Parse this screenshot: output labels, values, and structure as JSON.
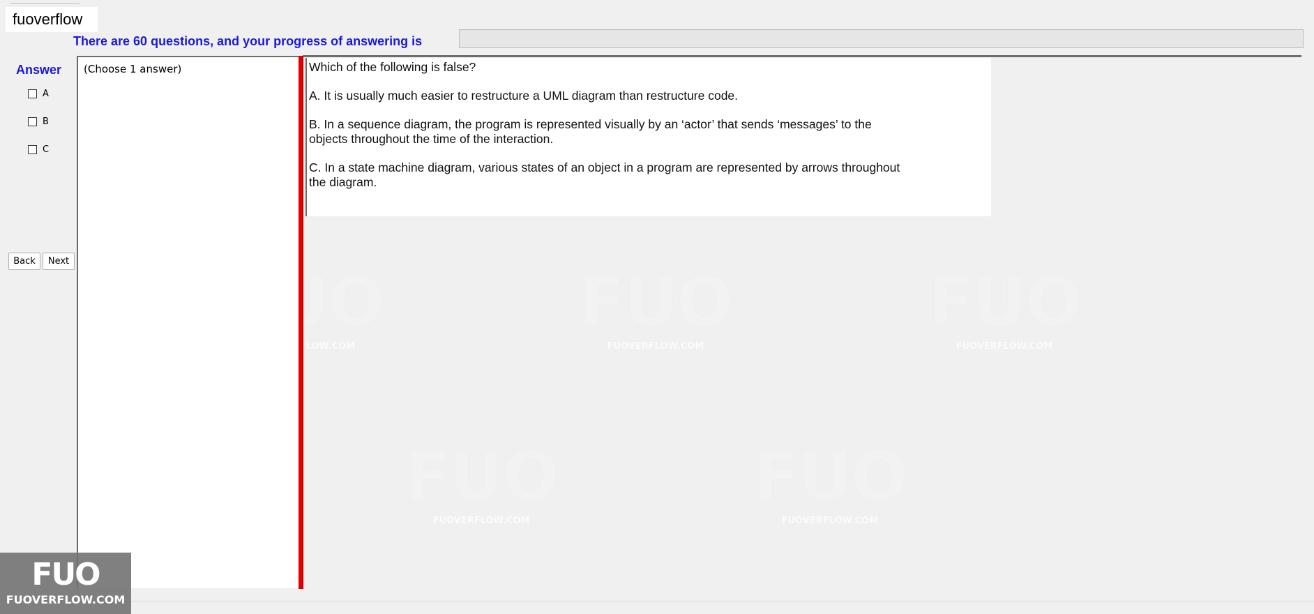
{
  "app": {
    "title": "fuoverflow"
  },
  "progress": {
    "label": "There are 60 questions, and your progress of answering is",
    "value_percent": 0,
    "fill_color": "#06b025"
  },
  "answer": {
    "heading": "Answer",
    "options": [
      {
        "label": "A",
        "checked": false
      },
      {
        "label": "B",
        "checked": false
      },
      {
        "label": "C",
        "checked": false
      }
    ]
  },
  "nav": {
    "back_label": "Back",
    "next_label": "Next"
  },
  "choose_panel": {
    "instruction": "(Choose 1 answer)"
  },
  "question": {
    "prompt": "Which of the following is false?",
    "lines": [
      "A.  It is usually much easier to restructure a UML diagram than restructure code.",
      "B.  In a sequence diagram, the program is represented visually by an ‘actor’ that sends ‘messages’ to the",
      "objects throughout the time of the interaction.",
      "C.  In a state machine diagram, various states of an object in a program are represented by arrows throughout",
      "the diagram."
    ]
  },
  "watermark": {
    "big": "FUO",
    "small": "FUOVERFLOW.COM"
  },
  "colors": {
    "heading_blue": "#1a1ad6",
    "splitter_red": "#e30000",
    "background": "#f0f0f0"
  }
}
